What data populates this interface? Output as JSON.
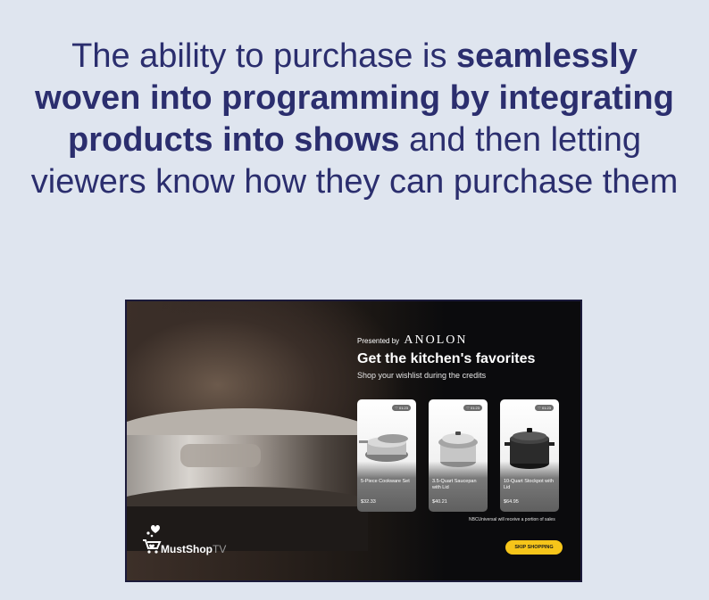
{
  "headline": {
    "part1": "The ability to purchase is ",
    "part2": "seamlessly woven into programming by integrating products into shows",
    "part3": " and then letting viewers know how they can purchase them"
  },
  "screen": {
    "presented_by": "Presented by",
    "brand": "ANOLON",
    "title": "Get the kitchen's favorites",
    "subtitle": "Shop your wishlist during the credits",
    "products": [
      {
        "tag": "♡ 01:23",
        "name": "5-Piece Cookware Set",
        "price": "$32.33"
      },
      {
        "tag": "♡ 01:23",
        "name": "3.5-Quart Saucepan with Lid",
        "price": "$40.21"
      },
      {
        "tag": "♡ 01:23",
        "name": "10-Quart Stockpot with Lid",
        "price": "$64.95"
      }
    ],
    "disclaimer": "NBCUniversal will receive a portion of sales",
    "skip_label": "SKIP SHOPPING",
    "logo_main": "MustShop",
    "logo_tv": "TV"
  }
}
